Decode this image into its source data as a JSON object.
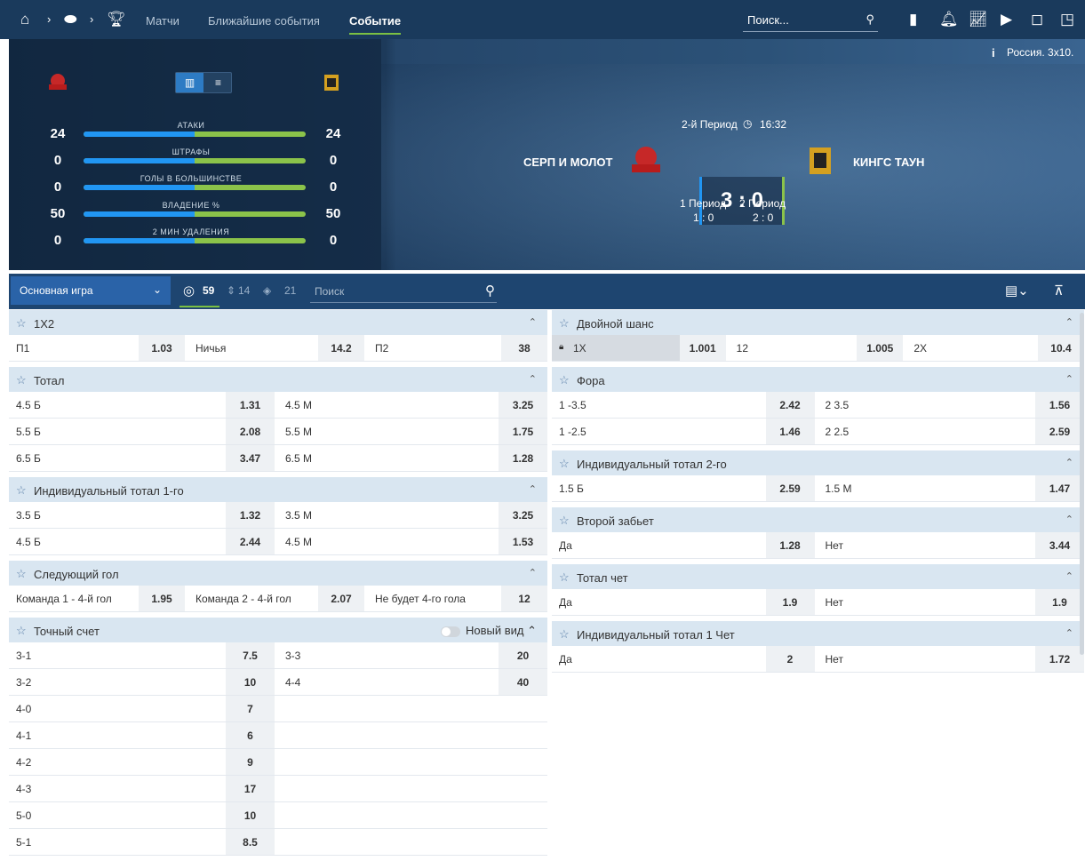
{
  "nav": {
    "links": [
      "Матчи",
      "Ближайшие события",
      "Событие"
    ],
    "search_placeholder": "Поиск..."
  },
  "hero": {
    "league": "Россия. 3х10.",
    "stats": [
      {
        "label": "АТАКИ",
        "left": "24",
        "right": "24",
        "left_share": 0.5
      },
      {
        "label": "ШТРАФЫ",
        "left": "0",
        "right": "0",
        "left_share": 0.5
      },
      {
        "label": "ГОЛЫ В БОЛЬШИНСТВЕ",
        "left": "0",
        "right": "0",
        "left_share": 0.5
      },
      {
        "label": "ВЛАДЕНИЕ %",
        "left": "50",
        "right": "50",
        "left_share": 0.5
      },
      {
        "label": "2 МИН УДАЛЕНИЯ",
        "left": "0",
        "right": "0",
        "left_share": 0.5
      }
    ],
    "period_status": "2-й Период",
    "time": "16:32",
    "team1": "СЕРП И МОЛОТ",
    "team2": "КИНГС ТАУН",
    "score": "3 : 0",
    "periods": [
      {
        "name": "1 Период",
        "score": "1 : 0"
      },
      {
        "name": "2 Период",
        "score": "2 : 0"
      }
    ]
  },
  "market_bar": {
    "select": "Основная игра",
    "counts": [
      "59",
      "14",
      "21"
    ],
    "search_placeholder": "Поиск"
  },
  "left_groups": {
    "g1x2": {
      "title": "1X2",
      "rows": [
        [
          {
            "l": "П1",
            "o": "1.03"
          },
          {
            "l": "Ничья",
            "o": "14.2"
          },
          {
            "l": "П2",
            "o": "38"
          }
        ]
      ]
    },
    "total": {
      "title": "Тотал",
      "rows": [
        [
          {
            "l": "4.5 Б",
            "o": "1.31"
          },
          {
            "l": "4.5 М",
            "o": "3.25"
          }
        ],
        [
          {
            "l": "5.5 Б",
            "o": "2.08"
          },
          {
            "l": "5.5 М",
            "o": "1.75"
          }
        ],
        [
          {
            "l": "6.5 Б",
            "o": "3.47"
          },
          {
            "l": "6.5 М",
            "o": "1.28"
          }
        ]
      ]
    },
    "ind1": {
      "title": "Индивидуальный тотал 1-го",
      "rows": [
        [
          {
            "l": "3.5 Б",
            "o": "1.32"
          },
          {
            "l": "3.5 М",
            "o": "3.25"
          }
        ],
        [
          {
            "l": "4.5 Б",
            "o": "2.44"
          },
          {
            "l": "4.5 М",
            "o": "1.53"
          }
        ]
      ]
    },
    "nextgoal": {
      "title": "Следующий гол",
      "rows": [
        [
          {
            "l": "Команда 1 - 4-й гол",
            "o": "1.95"
          },
          {
            "l": "Команда 2 - 4-й гол",
            "o": "2.07"
          },
          {
            "l": "Не будет 4-го гола",
            "o": "12"
          }
        ]
      ]
    },
    "exact": {
      "title": "Точный счет",
      "newview": "Новый вид",
      "rows": [
        [
          {
            "l": "3-1",
            "o": "7.5"
          },
          {
            "l": "3-3",
            "o": "20"
          }
        ],
        [
          {
            "l": "3-2",
            "o": "10"
          },
          {
            "l": "4-4",
            "o": "40"
          }
        ],
        [
          {
            "l": "4-0",
            "o": "7"
          }
        ],
        [
          {
            "l": "4-1",
            "o": "6"
          }
        ],
        [
          {
            "l": "4-2",
            "o": "9"
          }
        ],
        [
          {
            "l": "4-3",
            "o": "17"
          }
        ],
        [
          {
            "l": "5-0",
            "o": "10"
          }
        ],
        [
          {
            "l": "5-1",
            "o": "8.5"
          }
        ]
      ]
    }
  },
  "right_groups": {
    "dbl": {
      "title": "Двойной шанс",
      "rows": [
        [
          {
            "l": "1X",
            "o": "1.001",
            "locked": true
          },
          {
            "l": "12",
            "o": "1.005"
          },
          {
            "l": "2X",
            "o": "10.4"
          }
        ]
      ]
    },
    "fora": {
      "title": "Фора",
      "rows": [
        [
          {
            "l": "1 -3.5",
            "o": "2.42"
          },
          {
            "l": "2 3.5",
            "o": "1.56"
          }
        ],
        [
          {
            "l": "1 -2.5",
            "o": "1.46"
          },
          {
            "l": "2 2.5",
            "o": "2.59"
          }
        ]
      ]
    },
    "ind2": {
      "title": "Индивидуальный тотал 2-го",
      "rows": [
        [
          {
            "l": "1.5 Б",
            "o": "2.59"
          },
          {
            "l": "1.5 М",
            "o": "1.47"
          }
        ]
      ]
    },
    "second": {
      "title": "Второй забьет",
      "rows": [
        [
          {
            "l": "Да",
            "o": "1.28"
          },
          {
            "l": "Нет",
            "o": "3.44"
          }
        ]
      ]
    },
    "even": {
      "title": "Тотал чет",
      "rows": [
        [
          {
            "l": "Да",
            "o": "1.9"
          },
          {
            "l": "Нет",
            "o": "1.9"
          }
        ]
      ]
    },
    "ind1even": {
      "title": "Индивидуальный тотал 1 Чет",
      "rows": [
        [
          {
            "l": "Да",
            "o": "2"
          },
          {
            "l": "Нет",
            "o": "1.72"
          }
        ]
      ]
    }
  }
}
